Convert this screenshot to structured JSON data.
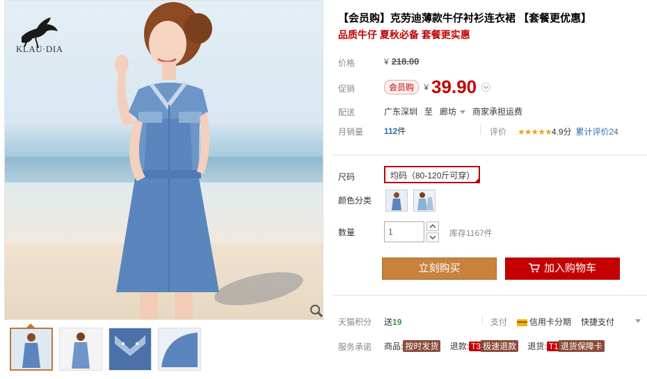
{
  "brand": {
    "name": "KLAU·DIA"
  },
  "product": {
    "title": "【会员购】克劳迪薄款牛仔衬衫连衣裙 【套餐更优惠】",
    "subtitle": "品质牛仔 夏秋必备 套餐更实惠"
  },
  "price": {
    "label": "价格",
    "currency": "¥",
    "original": "218.00"
  },
  "promo": {
    "label": "促销",
    "badge": "会员购",
    "currency": "¥",
    "price": "39.90"
  },
  "shipping": {
    "label": "配送",
    "from": "广东深圳",
    "to_word": "至",
    "to": "廊坊",
    "note": "商家承担运费"
  },
  "sales": {
    "label": "月销量",
    "count": "112",
    "unit": "件",
    "rating_label": "评价",
    "stars": "★★★★★",
    "score": "4.9分",
    "total_reviews": "累计评价24"
  },
  "size": {
    "label": "尺码",
    "selected": "均码（80-120斤可穿）"
  },
  "color": {
    "label": "颜色分类"
  },
  "quantity": {
    "label": "数量",
    "value": "1",
    "stock": "库存1167件"
  },
  "buttons": {
    "buy_now": "立刻购买",
    "add_to_cart": "加入购物车"
  },
  "points": {
    "label": "天猫积分",
    "prefix": "送",
    "value": "19"
  },
  "payment": {
    "label": "支付",
    "credit": "信用卡分期",
    "quick": "快捷支付"
  },
  "service": {
    "label": "服务承诺",
    "goods_prefix": "商品:",
    "goods_tag": "按时发货",
    "refund_prefix": "退款:",
    "refund_tag_a": "T3",
    "refund_tag_b": "极速退款",
    "return_prefix": "退货:",
    "return_tag_a": "T1",
    "return_tag_b": "退货保障卡"
  },
  "colors": {
    "price_red": "#c40000",
    "buy_orange": "#c8823c",
    "link_blue": "#2f6ea5",
    "points_green": "#339933"
  }
}
